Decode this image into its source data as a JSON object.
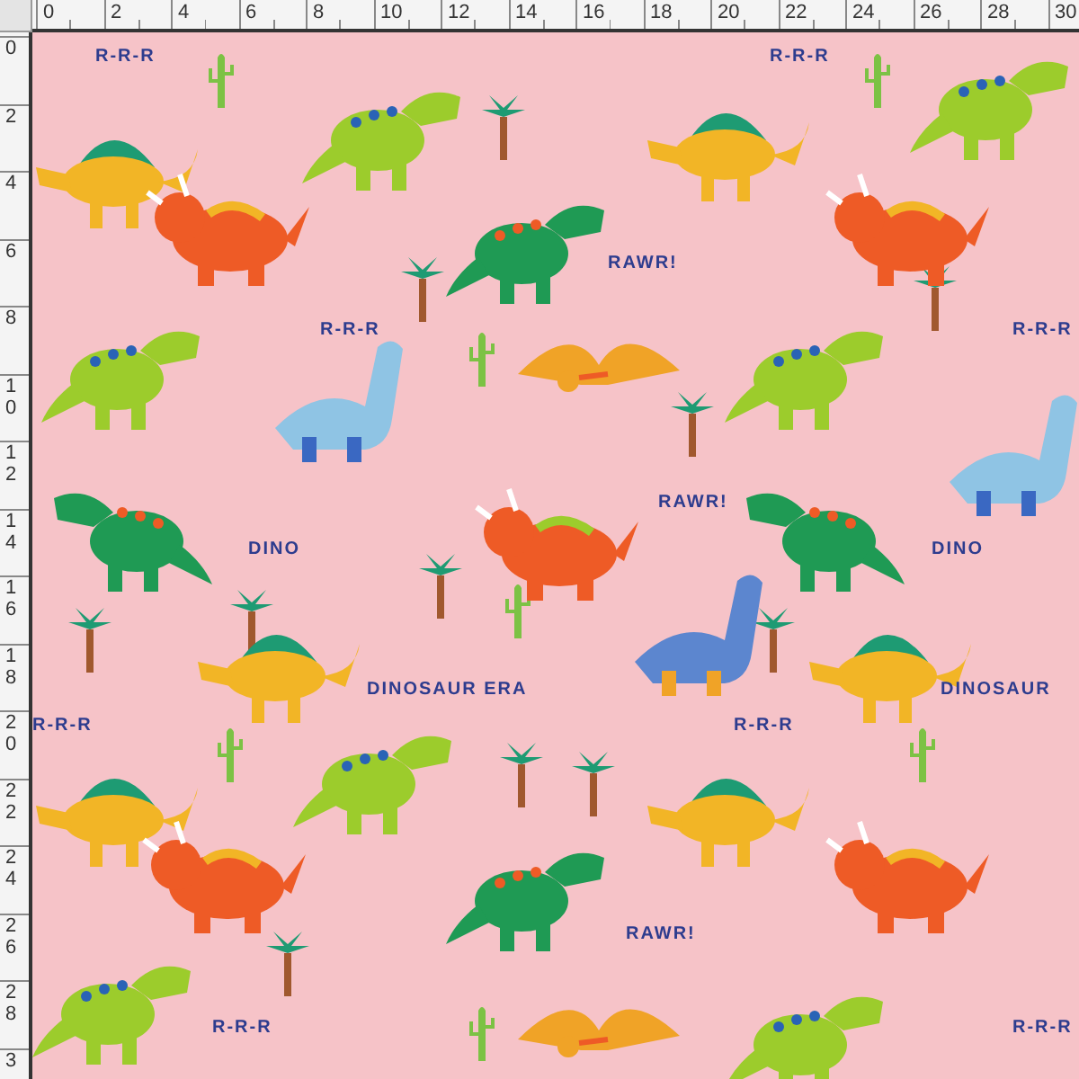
{
  "top_ruler": {
    "labels": [
      "0",
      "2",
      "4",
      "6",
      "8",
      "10",
      "12",
      "14",
      "16",
      "18",
      "20",
      "22",
      "24",
      "26",
      "28",
      "30"
    ]
  },
  "left_ruler": {
    "labels": [
      "0",
      "2",
      "4",
      "6",
      "8",
      "10",
      "12",
      "14",
      "16",
      "18",
      "20",
      "22",
      "24",
      "26",
      "28",
      "3"
    ]
  },
  "fabric": {
    "texts": [
      {
        "text": "R-R-R"
      },
      {
        "text": "R-R-R"
      },
      {
        "text": "R-R-R"
      },
      {
        "text": "R-R-R"
      },
      {
        "text": "R-R-R"
      },
      {
        "text": "R-R-R"
      },
      {
        "text": "R-R-R"
      },
      {
        "text": "R-R-R"
      },
      {
        "text": "RAWR!"
      },
      {
        "text": "RAWR!"
      },
      {
        "text": "RAWR!"
      },
      {
        "text": "DINO"
      },
      {
        "text": "DINO"
      },
      {
        "text": "DINOSAUR ERA"
      },
      {
        "text": "DINOSAUR"
      }
    ]
  }
}
